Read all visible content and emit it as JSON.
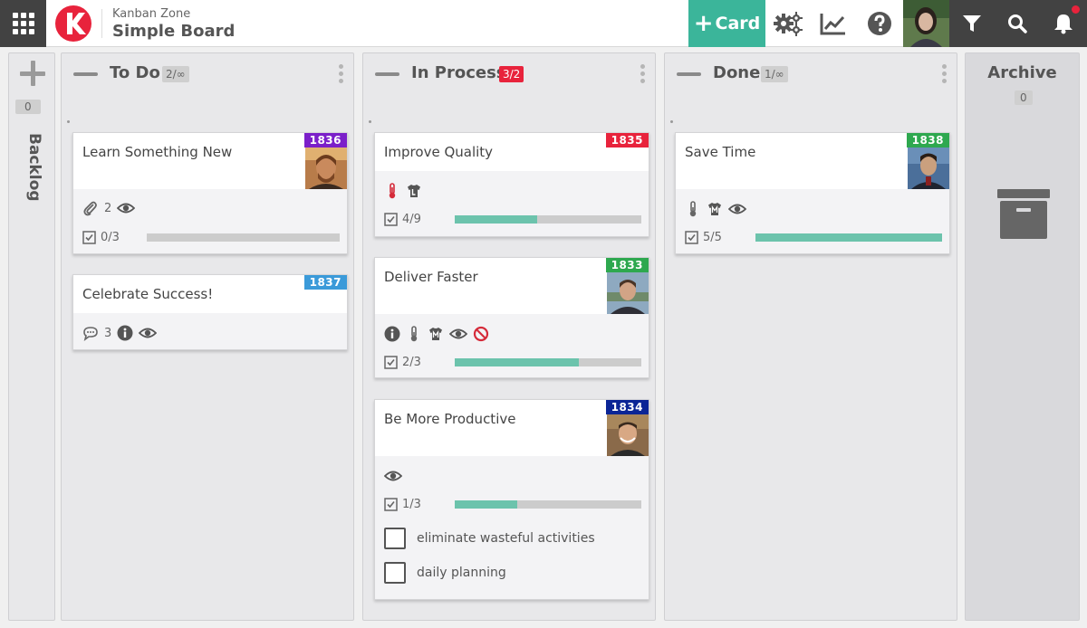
{
  "header": {
    "app_name": "Kanban Zone",
    "board_name": "Simple Board",
    "add_card_label": "Card",
    "add_card_plus": "+"
  },
  "colors": {
    "accent": "#3bb59a",
    "dark_bar": "#424242",
    "over_wip": "#e8233c",
    "progress": "#6cc3ac"
  },
  "backlog": {
    "count": "0",
    "label": "Backlog"
  },
  "archive": {
    "title": "Archive",
    "count": "0"
  },
  "columns": [
    {
      "title": "To Do",
      "wip": "2/∞",
      "cards": [
        {
          "id": "1836",
          "id_color": "#7b1fc9",
          "title": "Learn Something New",
          "attachments": "2",
          "progress_label": "0/3",
          "progress": 0
        },
        {
          "id": "1837",
          "id_color": "#3b9ad9",
          "title": "Celebrate Success!",
          "comments": "3"
        }
      ]
    },
    {
      "title": "In Process",
      "wip": "3/2",
      "cards": [
        {
          "id": "1835",
          "id_color": "#e8233c",
          "title": "Improve Quality",
          "progress_label": "4/9",
          "progress": 0.444
        },
        {
          "id": "1833",
          "id_color": "#2ea84f",
          "title": "Deliver Faster",
          "progress_label": "2/3",
          "progress": 0.667
        },
        {
          "id": "1834",
          "id_color": "#0b2596",
          "title": "Be More Productive",
          "progress_label": "1/3",
          "progress": 0.333,
          "checklist": [
            "eliminate wasteful activities",
            "daily planning"
          ]
        }
      ]
    },
    {
      "title": "Done",
      "wip": "1/∞",
      "cards": [
        {
          "id": "1838",
          "id_color": "#2ea84f",
          "title": "Save Time",
          "progress_label": "5/5",
          "progress": 1.0
        }
      ]
    }
  ]
}
